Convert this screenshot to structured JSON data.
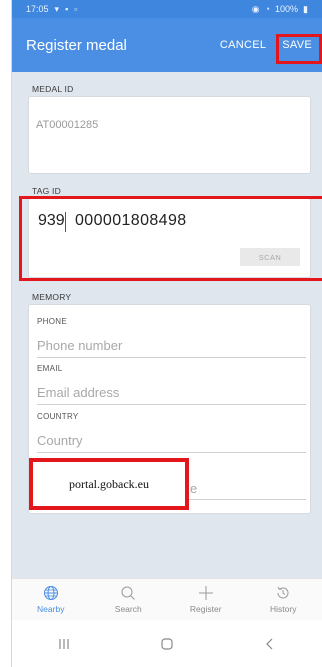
{
  "status_bar": {
    "time": "17:05",
    "battery": "100%"
  },
  "appbar": {
    "title": "Register medal",
    "cancel_label": "CANCEL",
    "save_label": "SAVE"
  },
  "medal": {
    "label": "MEDAL ID",
    "value": "AT00001285"
  },
  "tag": {
    "label": "TAG ID",
    "prefix": "939",
    "number": "000001808498",
    "scan_label": "SCAN"
  },
  "memory": {
    "label": "MEMORY",
    "fields": [
      {
        "label": "PHONE",
        "placeholder": "Phone number"
      },
      {
        "label": "EMAIL",
        "placeholder": "Email address"
      },
      {
        "label": "COUNTRY",
        "placeholder": "Country"
      }
    ],
    "overlay_text": "portal.goback.eu",
    "hidden_tail": "e"
  },
  "bottom_nav": {
    "items": [
      {
        "label": "Nearby",
        "icon": "globe-icon",
        "active": true
      },
      {
        "label": "Search",
        "icon": "search-icon",
        "active": false
      },
      {
        "label": "Register",
        "icon": "plus-icon",
        "active": false
      },
      {
        "label": "History",
        "icon": "history-icon",
        "active": false
      }
    ]
  },
  "colors": {
    "accent": "#4a8fe3",
    "highlight": "#e2161b",
    "background": "#dfe6ee"
  }
}
